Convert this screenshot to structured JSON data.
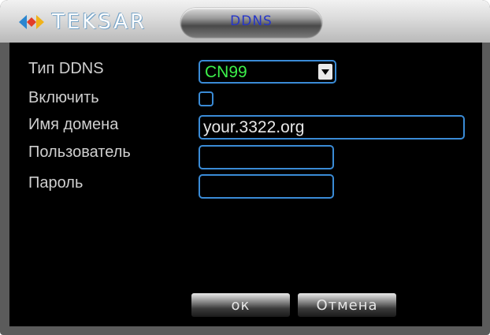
{
  "window": {
    "logo_text": "TEKSAR",
    "title": "DDNS"
  },
  "form": {
    "ddns_type_label": "Тип DDNS",
    "ddns_type_value": "CN99",
    "enable_label": "Включить",
    "enable_checked": false,
    "domain_label": "Имя домена",
    "domain_value": "your.3322.org",
    "user_label": "Пользователь",
    "user_value": "",
    "password_label": "Пароль",
    "password_value": ""
  },
  "buttons": {
    "ok_label": "ок",
    "cancel_label": "Отмена"
  },
  "colors": {
    "accent_border": "#3a8bd6",
    "select_text": "#3cf04a",
    "title_text": "#2636c8"
  }
}
